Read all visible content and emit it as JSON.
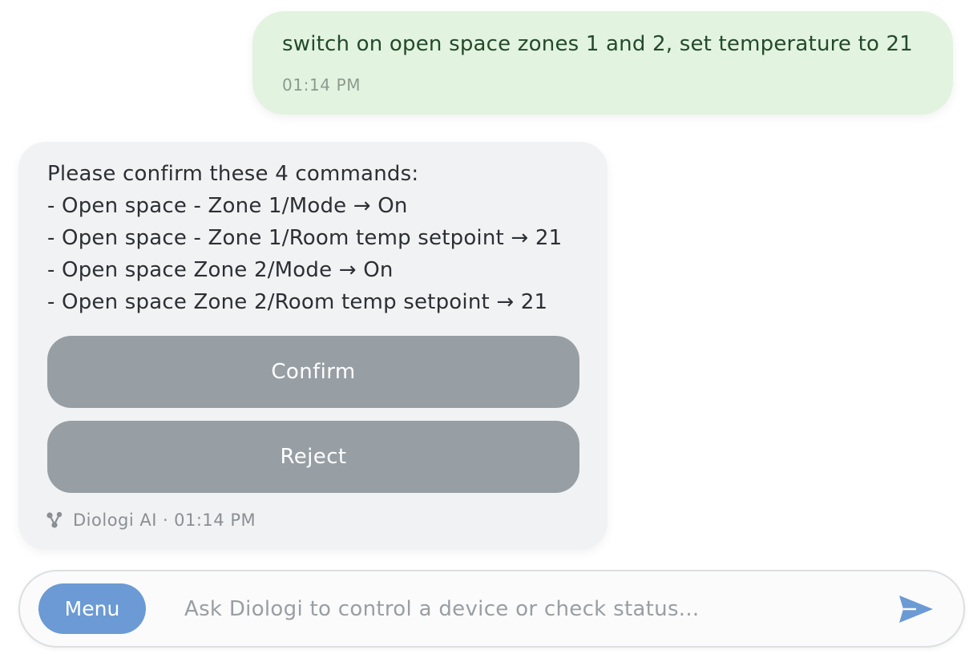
{
  "conversation": {
    "user_message": {
      "text": "switch on open space zones 1 and 2, set temperature to 21",
      "time": "01:14 PM"
    },
    "assistant_message": {
      "lines": [
        "Please confirm these 4 commands:",
        "- Open space - Zone 1/Mode → On",
        "- Open space - Zone 1/Room temp setpoint → 21",
        "- Open space Zone 2/Mode → On",
        "- Open space Zone 2/Room temp setpoint → 21"
      ],
      "confirm_label": "Confirm",
      "reject_label": "Reject",
      "sender": "Diologi AI",
      "separator": "·",
      "time": "01:14 PM",
      "sender_icon": "share-nodes-icon"
    }
  },
  "composer": {
    "menu_label": "Menu",
    "placeholder": "Ask Diologi to control a device or check status...",
    "value": "",
    "send_icon": "send-arrow-icon"
  },
  "colors": {
    "user_bubble": "#e2f3e0",
    "assistant_bubble": "#f1f2f4",
    "action_button": "#979fa4",
    "menu_button": "#6b9ad4",
    "send_icon": "#6b9ad4"
  }
}
